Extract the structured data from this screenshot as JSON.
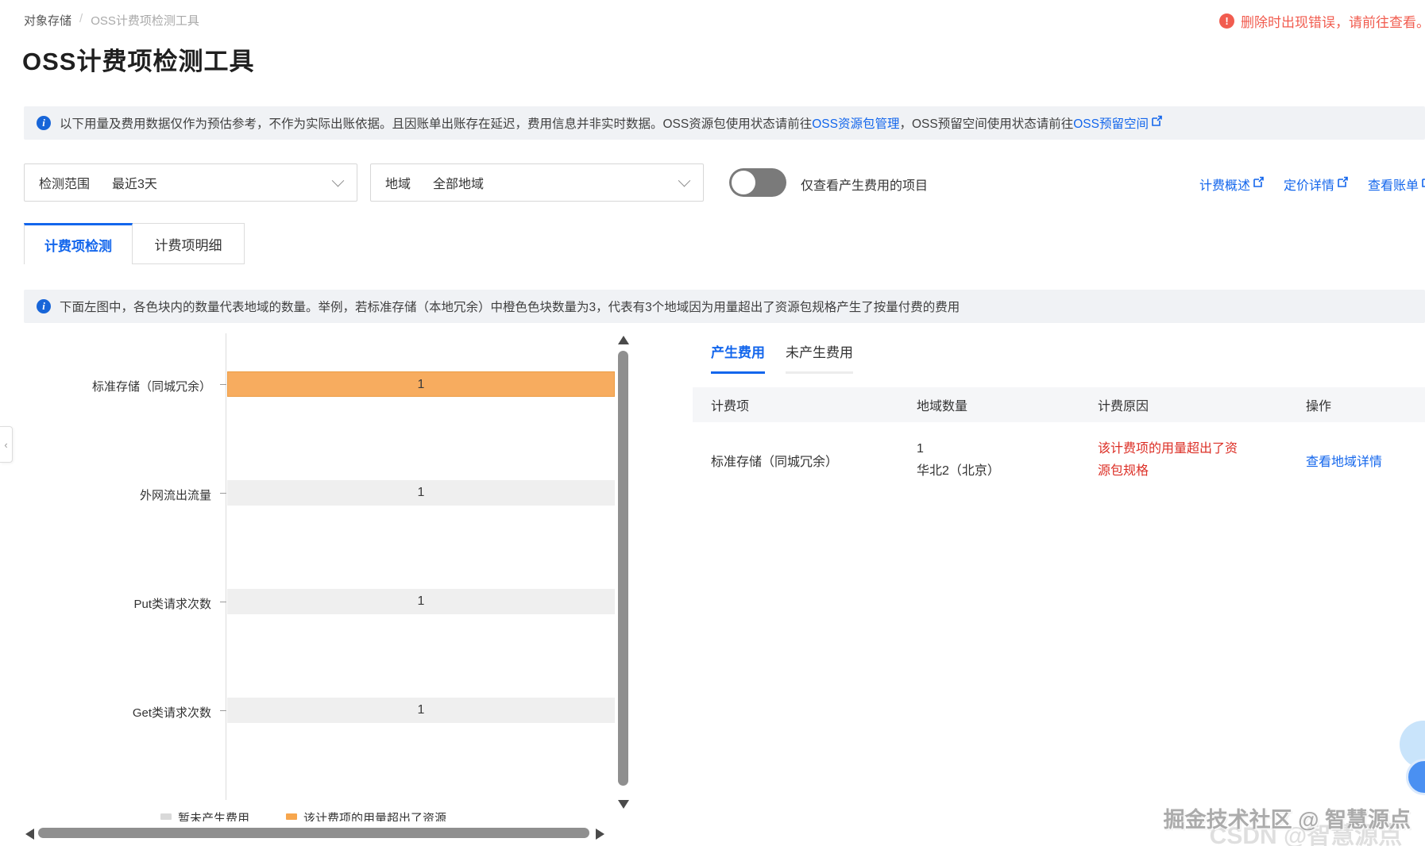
{
  "breadcrumb": {
    "parent": "对象存储",
    "separator": "/",
    "current": "OSS计费项检测工具"
  },
  "alert_top": {
    "text": "删除时出现错误，请前往查看。"
  },
  "page": {
    "title": "OSS计费项检测工具"
  },
  "notice_top": {
    "text_1": "以下用量及费用数据仅作为预估参考，不作为实际出账依据。且因账单出账存在延迟，费用信息并非实时数据。OSS资源包使用状态请前往",
    "link_1": "OSS资源包管理",
    "text_2": "，OSS预留空间使用状态请前往",
    "link_2": "OSS预留空间"
  },
  "filters": {
    "range_label": "检测范围",
    "range_value": "最近3天",
    "region_label": "地域",
    "region_value": "全部地域",
    "toggle_label": "仅查看产生费用的项目",
    "toggle_state": "off",
    "links": [
      {
        "label": "计费概述"
      },
      {
        "label": "定价详情"
      },
      {
        "label": "查看账单"
      }
    ]
  },
  "tabs": {
    "items": [
      {
        "label": "计费项检测",
        "active": true
      },
      {
        "label": "计费项明细",
        "active": false
      }
    ]
  },
  "notice_chart": {
    "text": "下面左图中，各色块内的数量代表地域的数量。举例，若标准存储（本地冗余）中橙色色块数量为3，代表有3个地域因为用量超出了资源包规格产生了按量付费的费用"
  },
  "chart_data": {
    "type": "bar",
    "orientation": "horizontal",
    "categories": [
      "标准存储（同城冗余）",
      "外网流出流量",
      "Put类请求次数",
      "Get类请求次数"
    ],
    "values": [
      1,
      1,
      1,
      1
    ],
    "bar_colors": [
      "#f7ac5f",
      "#efefef",
      "#efefef",
      "#efefef"
    ],
    "highlight_meaning": "橙色=该计费项的用量超出了资源包规格",
    "legend": [
      {
        "label": "暂未产生费用",
        "color": "#d9d9d9"
      },
      {
        "label": "该计费项的用量超出了资源",
        "color": "#f7a64d"
      }
    ],
    "xlabel": "",
    "ylabel": "",
    "grid": false
  },
  "panel": {
    "tabs": [
      {
        "label": "产生费用",
        "active": true
      },
      {
        "label": "未产生费用",
        "active": false
      }
    ],
    "table": {
      "headers": [
        "计费项",
        "地域数量",
        "计费原因",
        "操作"
      ],
      "row": {
        "item": "标准存储（同城冗余）",
        "region_count": "1",
        "region_name": "华北2（北京）",
        "reason": "该计费项的用量超出了资源包规格",
        "action": "查看地域详情"
      }
    }
  },
  "watermark": {
    "front": "掘金技术社区 @ 智慧源点",
    "back": "CSDN @智慧源点"
  },
  "colors": {
    "accent_blue": "#1366ec",
    "bar_orange": "#f7ac5f",
    "bar_gray": "#efefef",
    "error_coral": "#f15c4f",
    "reason_red": "#dc2f26",
    "notice_bg": "#f0f2f5",
    "table_header_bg": "#f5f6f8"
  }
}
